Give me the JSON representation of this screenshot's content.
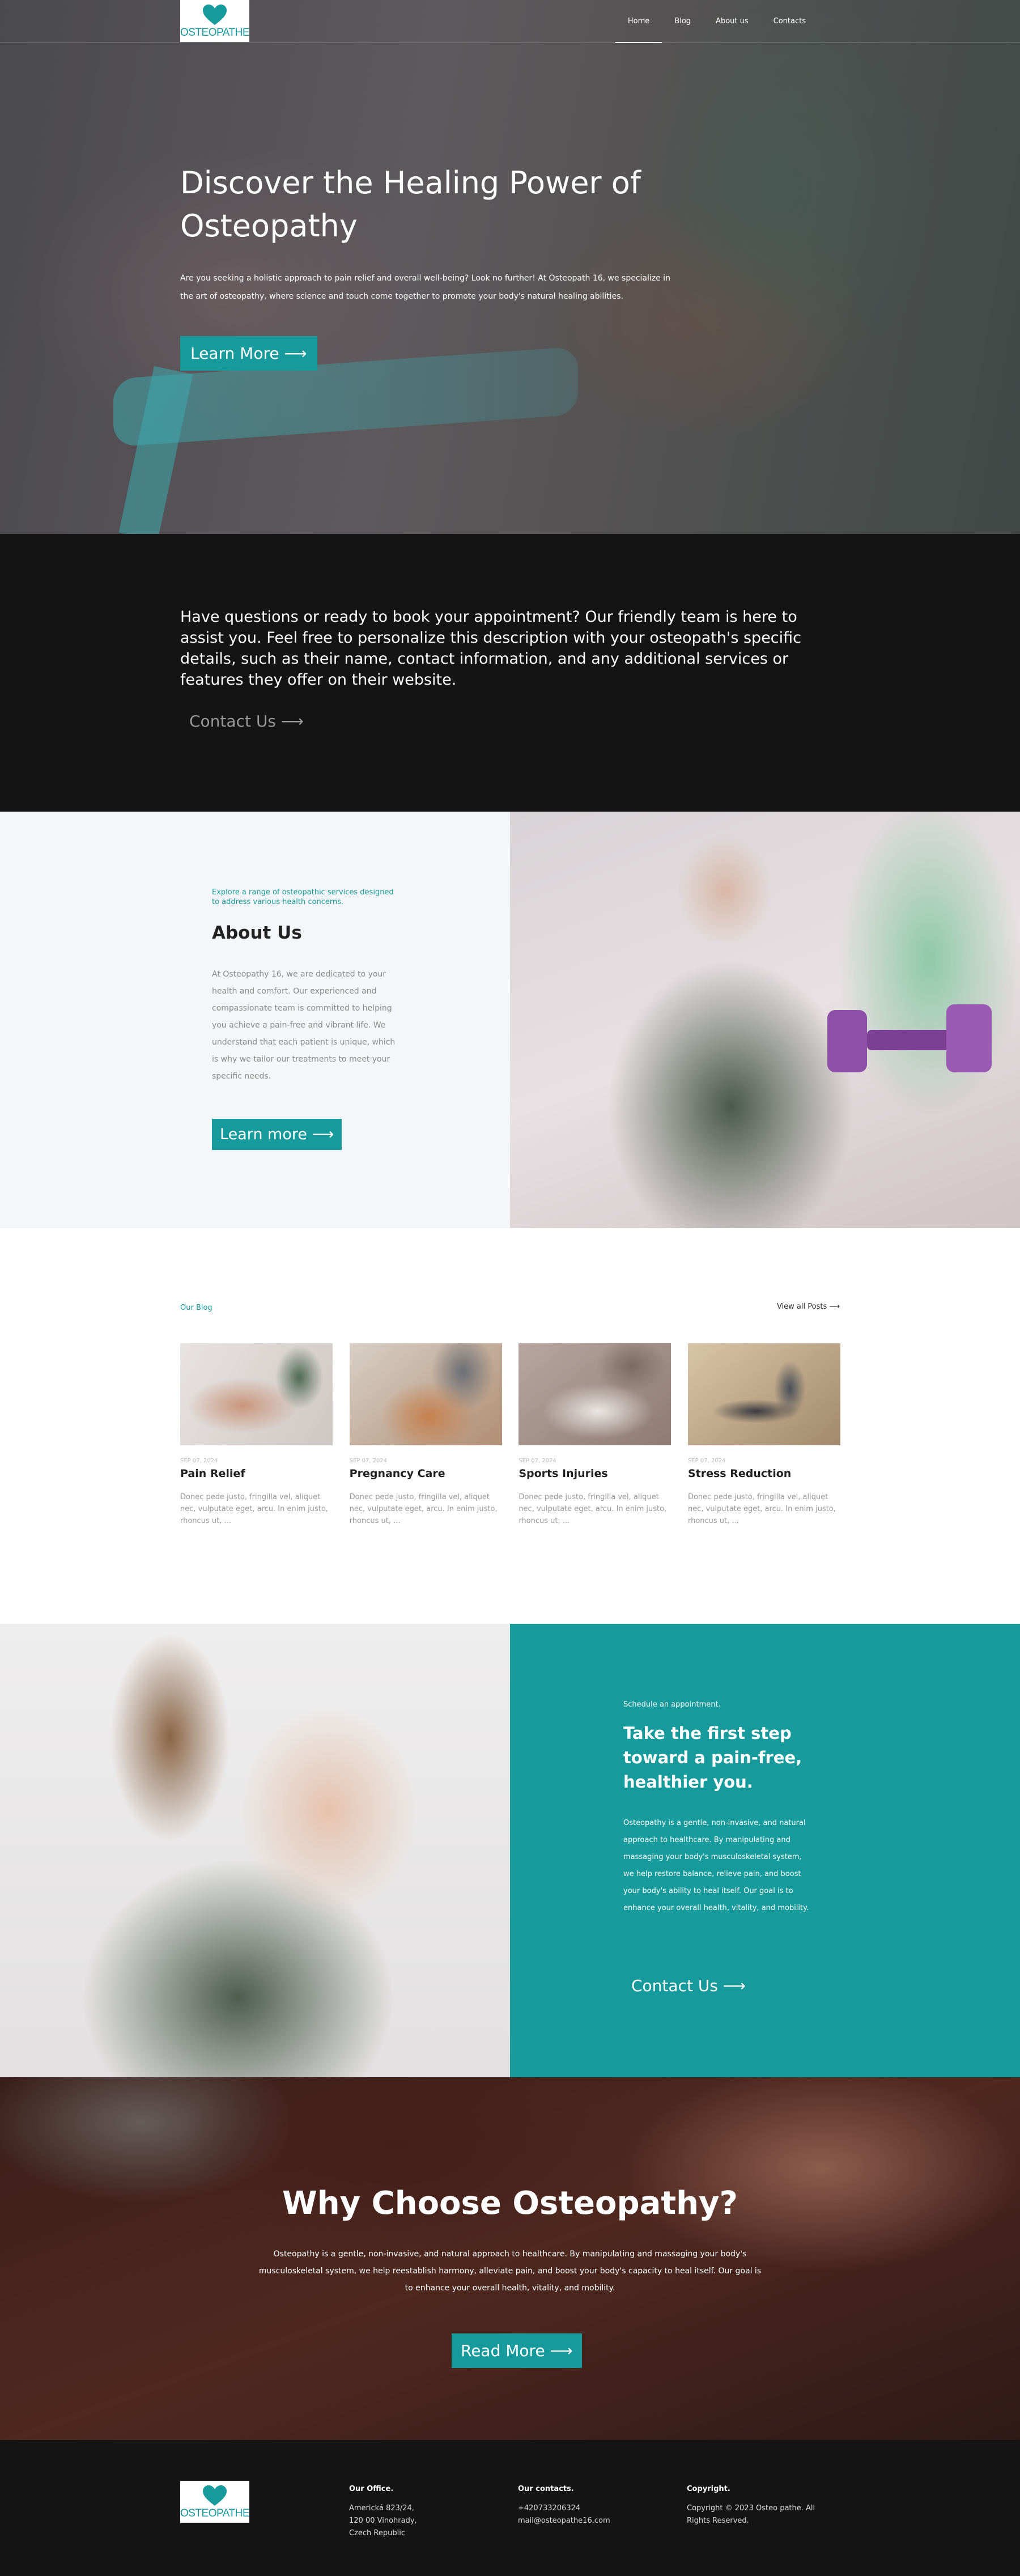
{
  "brand": {
    "logo_text": "OSTEOPATHE",
    "accent": "#169a9b",
    "dark": "#141414"
  },
  "nav": {
    "items": [
      {
        "label": "Home",
        "active": true
      },
      {
        "label": "Blog",
        "active": false
      },
      {
        "label": "About us",
        "active": false
      },
      {
        "label": "Contacts",
        "active": false
      }
    ]
  },
  "hero": {
    "title": "Discover the Healing Power of Osteopathy",
    "text": "Are you seeking a holistic approach to pain relief and overall well-being? Look no further! At Osteopath 16, we specialize in the art of osteopathy, where science and touch come together to promote your body's natural healing abilities.",
    "button": "Learn More ⟶"
  },
  "contact_cta": {
    "text": "Have questions or ready to book your appointment? Our friendly team is here to assist you. Feel free to personalize this description with your osteopath's specific details, such as their name, contact information, and any additional services or features they offer on their website.",
    "button": "Contact Us ⟶"
  },
  "about": {
    "kicker": "Explore a range of osteopathic services designed to address various health concerns.",
    "title": "About Us",
    "text": "At Osteopathy 16, we are dedicated to your health and comfort. Our experienced and compassionate team is committed to helping you achieve a pain-free and vibrant life. We understand that each patient is unique, which is why we tailor our treatments to meet your specific needs.",
    "button": "Learn more ⟶"
  },
  "blog": {
    "kicker": "Our Blog",
    "view_all": "View all Posts ⟶",
    "posts": [
      {
        "date": "SEP 07, 2024",
        "title": "Pain Relief",
        "excerpt": "Donec pede justo, fringilla vel, aliquet nec, vulputate eget, arcu. In enim justo, rhoncus ut, ..."
      },
      {
        "date": "SEP 07, 2024",
        "title": "Pregnancy Care",
        "excerpt": "Donec pede justo, fringilla vel, aliquet nec, vulputate eget, arcu. In enim justo, rhoncus ut, ..."
      },
      {
        "date": "SEP 07, 2024",
        "title": "Sports Injuries",
        "excerpt": "Donec pede justo, fringilla vel, aliquet nec, vulputate eget, arcu. In enim justo, rhoncus ut, ..."
      },
      {
        "date": "SEP 07, 2024",
        "title": "Stress Reduction",
        "excerpt": "Donec pede justo, fringilla vel, aliquet nec, vulputate eget, arcu. In enim justo, rhoncus ut, ..."
      }
    ]
  },
  "schedule": {
    "kicker": "Schedule an appointment.",
    "title": "Take the first step toward a pain-free, healthier you.",
    "text": "Osteopathy is a gentle, non-invasive, and natural approach to healthcare. By manipulating and massaging your body's musculoskeletal system, we help restore balance, relieve pain, and boost your body's ability to heal itself. Our goal is to enhance your overall health, vitality, and mobility.",
    "button": "Contact Us ⟶"
  },
  "why": {
    "title": "Why Choose Osteopathy?",
    "text": "Osteopathy is a gentle, non-invasive, and natural approach to healthcare. By manipulating and massaging your body's musculoskeletal system, we help reestablish harmony, alleviate pain, and boost your body's capacity to heal itself. Our goal is to enhance your overall health, vitality, and mobility.",
    "button": "Read More ⟶"
  },
  "footer": {
    "office": {
      "heading": "Our Office.",
      "line1": "Americká 823/24,",
      "line2": "120 00 Vinohrady,",
      "line3": "Czech Republic"
    },
    "contacts": {
      "heading": "Our contacts.",
      "phone": "+420733206324",
      "email": "mail@osteopathe16.com"
    },
    "copyright": {
      "heading": "Copyright.",
      "text": "Copyright © 2023 Osteo pathe. All Rights Reserved."
    }
  }
}
